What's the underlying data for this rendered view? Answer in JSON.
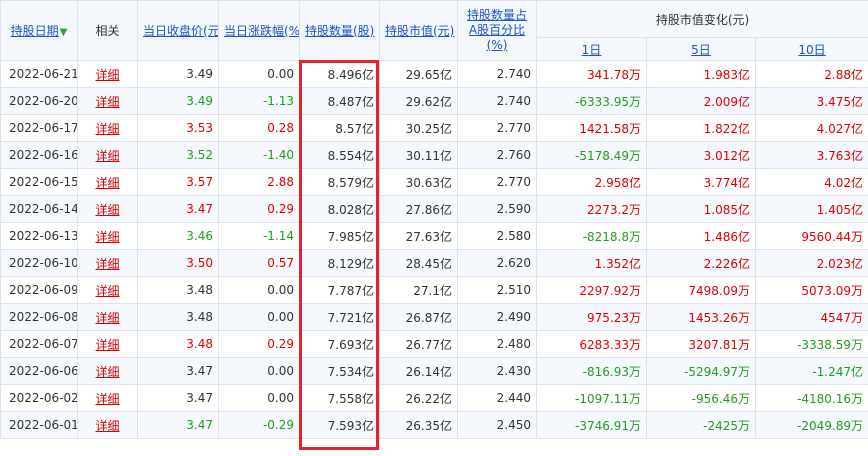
{
  "headers": {
    "date": "持股日期",
    "related": "相关",
    "close": "当日收盘价(元)",
    "change": "当日涨跌幅(%)",
    "shares": "持股数量(股)",
    "mktval": "持股市值(元)",
    "pct_a": "持股数量占A股百分比(%)",
    "mktchg": "持股市值变化(元)",
    "d1": "1日",
    "d5": "5日",
    "d10": "10日"
  },
  "colors": {
    "red": "#e00000",
    "green": "#1e9e1e",
    "link": "#1a56c7",
    "highlight": "#e8222a"
  },
  "rows": [
    {
      "date": "2022-06-21",
      "link": "详细",
      "close": "3.49",
      "change": "0.00",
      "shares": "8.496亿",
      "mktval": "29.65亿",
      "pct": "2.740",
      "d1": "341.78万",
      "d5": "1.983亿",
      "d10": "2.88亿",
      "cc": "blk",
      "chc": "blk",
      "c1": "red",
      "c5": "red",
      "c10": "red"
    },
    {
      "date": "2022-06-20",
      "link": "详细",
      "close": "3.49",
      "change": "-1.13",
      "shares": "8.487亿",
      "mktval": "29.62亿",
      "pct": "2.740",
      "d1": "-6333.95万",
      "d5": "2.009亿",
      "d10": "3.475亿",
      "cc": "green",
      "chc": "green",
      "c1": "green",
      "c5": "red",
      "c10": "red"
    },
    {
      "date": "2022-06-17",
      "link": "详细",
      "close": "3.53",
      "change": "0.28",
      "shares": "8.57亿",
      "mktval": "30.25亿",
      "pct": "2.770",
      "d1": "1421.58万",
      "d5": "1.822亿",
      "d10": "4.027亿",
      "cc": "red",
      "chc": "red",
      "c1": "red",
      "c5": "red",
      "c10": "red"
    },
    {
      "date": "2022-06-16",
      "link": "详细",
      "close": "3.52",
      "change": "-1.40",
      "shares": "8.554亿",
      "mktval": "30.11亿",
      "pct": "2.760",
      "d1": "-5178.49万",
      "d5": "3.012亿",
      "d10": "3.763亿",
      "cc": "green",
      "chc": "green",
      "c1": "green",
      "c5": "red",
      "c10": "red"
    },
    {
      "date": "2022-06-15",
      "link": "详细",
      "close": "3.57",
      "change": "2.88",
      "shares": "8.579亿",
      "mktval": "30.63亿",
      "pct": "2.770",
      "d1": "2.958亿",
      "d5": "3.774亿",
      "d10": "4.02亿",
      "cc": "red",
      "chc": "red",
      "c1": "red",
      "c5": "red",
      "c10": "red"
    },
    {
      "date": "2022-06-14",
      "link": "详细",
      "close": "3.47",
      "change": "0.29",
      "shares": "8.028亿",
      "mktval": "27.86亿",
      "pct": "2.590",
      "d1": "2273.2万",
      "d5": "1.085亿",
      "d10": "1.405亿",
      "cc": "red",
      "chc": "red",
      "c1": "red",
      "c5": "red",
      "c10": "red"
    },
    {
      "date": "2022-06-13",
      "link": "详细",
      "close": "3.46",
      "change": "-1.14",
      "shares": "7.985亿",
      "mktval": "27.63亿",
      "pct": "2.580",
      "d1": "-8218.8万",
      "d5": "1.486亿",
      "d10": "9560.44万",
      "cc": "green",
      "chc": "green",
      "c1": "green",
      "c5": "red",
      "c10": "red"
    },
    {
      "date": "2022-06-10",
      "link": "详细",
      "close": "3.50",
      "change": "0.57",
      "shares": "8.129亿",
      "mktval": "28.45亿",
      "pct": "2.620",
      "d1": "1.352亿",
      "d5": "2.226亿",
      "d10": "2.023亿",
      "cc": "red",
      "chc": "red",
      "c1": "red",
      "c5": "red",
      "c10": "red"
    },
    {
      "date": "2022-06-09",
      "link": "详细",
      "close": "3.48",
      "change": "0.00",
      "shares": "7.787亿",
      "mktval": "27.1亿",
      "pct": "2.510",
      "d1": "2297.92万",
      "d5": "7498.09万",
      "d10": "5073.09万",
      "cc": "blk",
      "chc": "blk",
      "c1": "red",
      "c5": "red",
      "c10": "red"
    },
    {
      "date": "2022-06-08",
      "link": "详细",
      "close": "3.48",
      "change": "0.00",
      "shares": "7.721亿",
      "mktval": "26.87亿",
      "pct": "2.490",
      "d1": "975.23万",
      "d5": "1453.26万",
      "d10": "4547万",
      "cc": "blk",
      "chc": "blk",
      "c1": "red",
      "c5": "red",
      "c10": "red"
    },
    {
      "date": "2022-06-07",
      "link": "详细",
      "close": "3.48",
      "change": "0.29",
      "shares": "7.693亿",
      "mktval": "26.77亿",
      "pct": "2.480",
      "d1": "6283.33万",
      "d5": "3207.81万",
      "d10": "-3338.59万",
      "cc": "red",
      "chc": "red",
      "c1": "red",
      "c5": "red",
      "c10": "green"
    },
    {
      "date": "2022-06-06",
      "link": "详细",
      "close": "3.47",
      "change": "0.00",
      "shares": "7.534亿",
      "mktval": "26.14亿",
      "pct": "2.430",
      "d1": "-816.93万",
      "d5": "-5294.97万",
      "d10": "-1.247亿",
      "cc": "blk",
      "chc": "blk",
      "c1": "green",
      "c5": "green",
      "c10": "green"
    },
    {
      "date": "2022-06-02",
      "link": "详细",
      "close": "3.47",
      "change": "0.00",
      "shares": "7.558亿",
      "mktval": "26.22亿",
      "pct": "2.440",
      "d1": "-1097.11万",
      "d5": "-956.46万",
      "d10": "-4180.16万",
      "cc": "blk",
      "chc": "blk",
      "c1": "green",
      "c5": "green",
      "c10": "green"
    },
    {
      "date": "2022-06-01",
      "link": "详细",
      "close": "3.47",
      "change": "-0.29",
      "shares": "7.593亿",
      "mktval": "26.35亿",
      "pct": "2.450",
      "d1": "-3746.91万",
      "d5": "-2425万",
      "d10": "-2049.89万",
      "cc": "green",
      "chc": "green",
      "c1": "green",
      "c5": "green",
      "c10": "green"
    }
  ]
}
